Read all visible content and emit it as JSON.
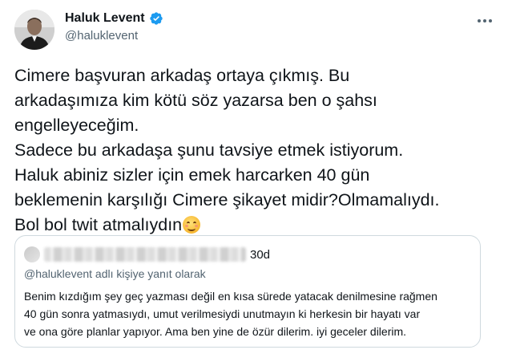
{
  "author": {
    "display_name": "Haluk Levent",
    "handle": "@haluklevent",
    "verified": true,
    "avatar_icon": "avatar-photo"
  },
  "tweet": {
    "lines": [
      "Cimere başvuran arkadaş ortaya çıkmış. Bu",
      "arkadaşımıza kim kötü söz yazarsa ben o şahsı",
      "engelleyeceğim.",
      "Sadece bu arkadaşa şunu tavsiye etmek istiyorum.",
      "Haluk abiniz sizler için emek harcarken 40 gün",
      "beklemenin karşılığı Cimere şikayet midir?Olmamalıydı.",
      "Bol bol twit atmalıydın"
    ],
    "emoji": "smiling-face-with-smiling-eyes"
  },
  "quoted": {
    "time": "30d",
    "reply_context": "@haluklevent adlı kişiye yanıt olarak",
    "lines": [
      "Benim kızdığım şey geç yazması değil en kısa sürede yatacak denilmesine rağmen",
      "40 gün sonra yatmasıydı, umut verilmesiydi unutmayın ki herkesin bir hayatı var",
      "ve ona göre planlar yapıyor. Ama ben yine de özür dilerim. iyi geceler dilerim."
    ]
  },
  "colors": {
    "verified_blue": "#1d9bf0",
    "text_primary": "#0f1419",
    "text_secondary": "#536471",
    "border": "#cfd9de"
  }
}
